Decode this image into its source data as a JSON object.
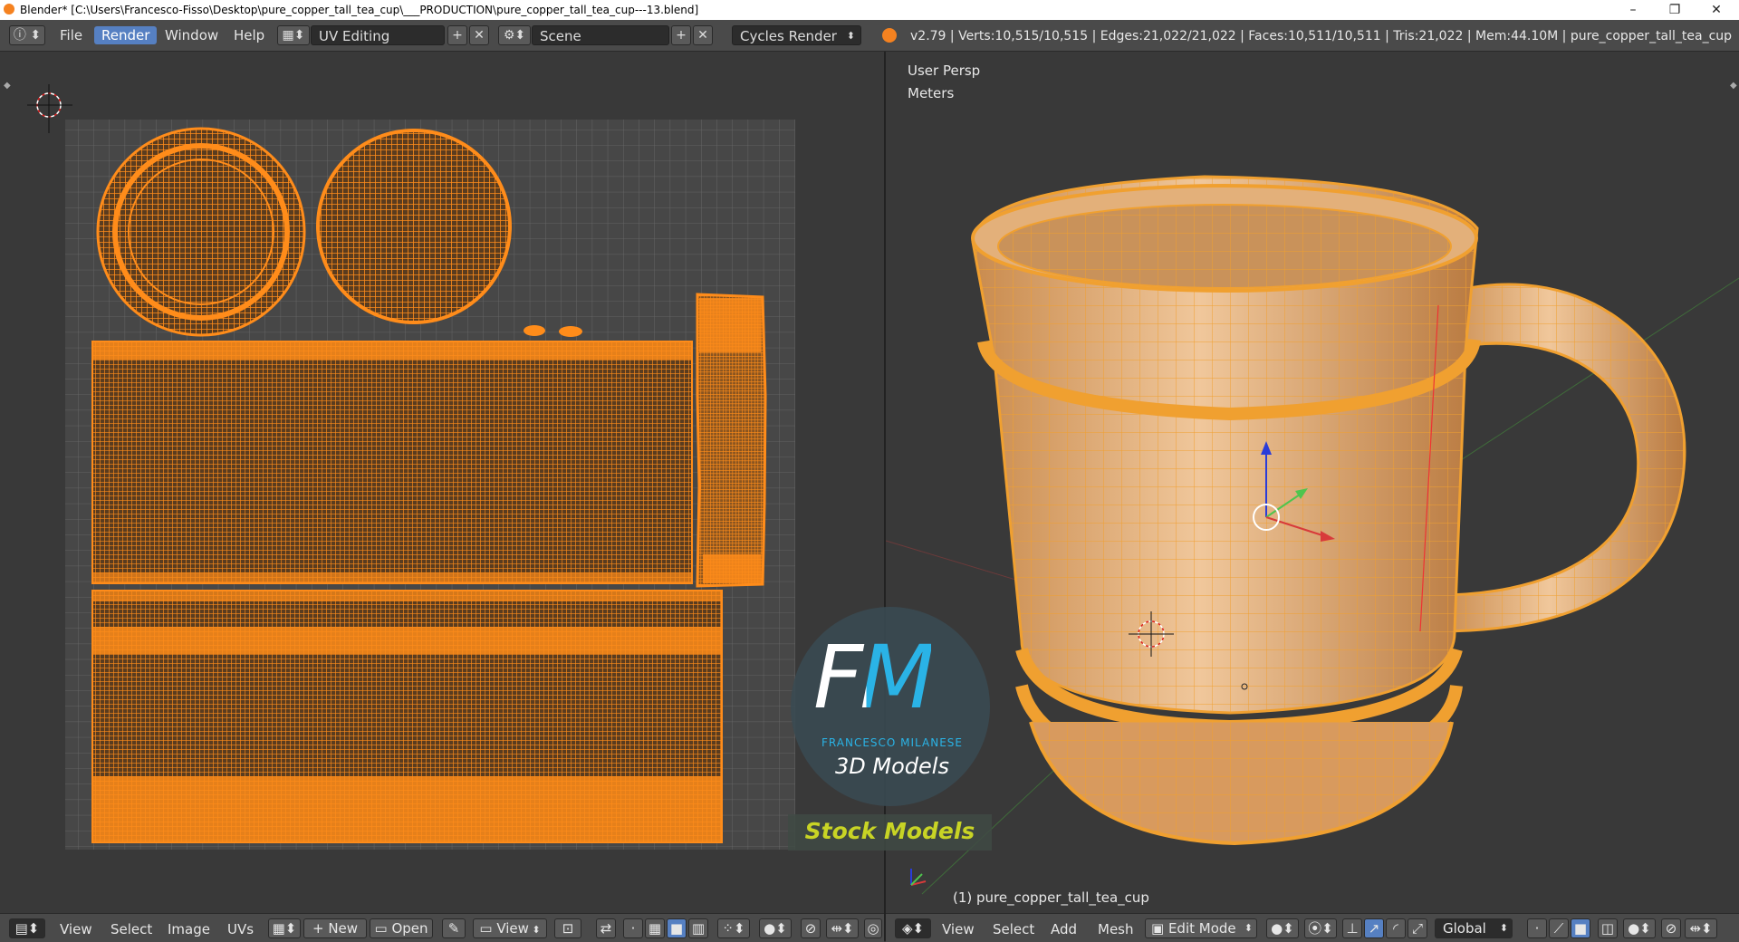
{
  "window": {
    "title": "Blender* [C:\\Users\\Francesco-Fisso\\Desktop\\pure_copper_tall_tea_cup\\___PRODUCTION\\pure_copper_tall_tea_cup---13.blend]",
    "minimize": "–",
    "maximize": "❐",
    "close": "✕"
  },
  "header": {
    "menus": [
      "File",
      "Render",
      "Window",
      "Help"
    ],
    "active_menu": "Render",
    "screen_layout": "UV Editing",
    "scene": "Scene",
    "render_engine": "Cycles Render",
    "stats": "v2.79 | Verts:10,515/10,515 | Edges:21,022/21,022 | Faces:10,511/10,511 | Tris:21,022 | Mem:44.10M | pure_copper_tall_tea_cup"
  },
  "viewport": {
    "perspective_label": "User Persp",
    "units_label": "Meters",
    "object_label": "(1) pure_copper_tall_tea_cup"
  },
  "uv_footer": {
    "menus": [
      "View",
      "Select",
      "Image",
      "UVs"
    ],
    "new_label": "New",
    "open_label": "Open",
    "view_label": "View"
  },
  "viewport_footer": {
    "menus": [
      "View",
      "Select",
      "Add",
      "Mesh"
    ],
    "mode": "Edit Mode",
    "orientation": "Global"
  },
  "watermark": {
    "initials": "FM",
    "brand": "FRANCESCO MILANESE",
    "line1": "3D Models",
    "line2": "Stock Models"
  },
  "colors": {
    "uv_orange": "#ff8c1a",
    "mesh_orange": "#f0a040",
    "active_blue": "#5680c2",
    "editor_bg": "#393939"
  }
}
